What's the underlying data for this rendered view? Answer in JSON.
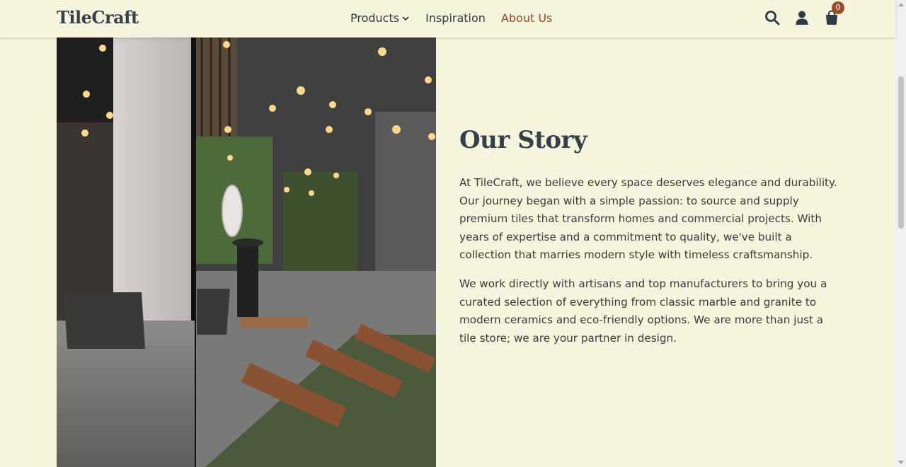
{
  "brand": {
    "name": "TileCraft"
  },
  "nav": {
    "items": [
      {
        "label": "Products"
      },
      {
        "label": "Inspiration"
      },
      {
        "label": "About Us"
      }
    ],
    "active_color": "#9a4b28"
  },
  "header_icons": [
    "search-icon",
    "user-icon",
    "cart-icon"
  ],
  "cart": {
    "count": "0"
  },
  "story": {
    "title": "Our Story",
    "paragraphs": [
      "At TileCraft, we believe every space deserves elegance and durability. Our journey began with a simple passion: to source and supply premium tiles that transform homes and commercial projects. With years of expertise and a commitment to quality, we've built a collection that marries modern style with timeless craftsmanship.",
      "We work directly with artisans and top manufacturers to bring you a curated selection of everything from classic marble and granite to modern ceramics and eco-friendly options. We are more than just a tile store; we are your partner in design."
    ]
  },
  "colors": {
    "background": "#f5f4dc",
    "heading": "#36404a",
    "accent": "#9a4b28"
  }
}
